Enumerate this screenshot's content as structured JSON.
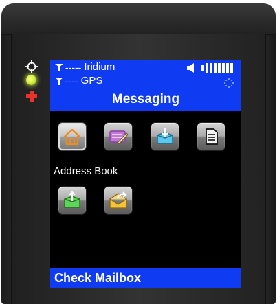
{
  "status": {
    "iridium_signal": "-----",
    "iridium_label": "Iridium",
    "gps_signal": "----",
    "gps_label": "GPS"
  },
  "screen": {
    "title": "Messaging",
    "focused_label": "Address Book",
    "softkey_label": "Check Mailbox"
  },
  "icons": {
    "row1": [
      "home-icon",
      "compose-message-icon",
      "inbox-icon",
      "document-icon"
    ],
    "row2": [
      "outbox-icon",
      "reply-envelope-icon"
    ]
  },
  "colors": {
    "screen_header": "#0f3bf2",
    "screen_background": "#000000",
    "led": "#d8f03a",
    "alert_cross": "#e8322a"
  }
}
